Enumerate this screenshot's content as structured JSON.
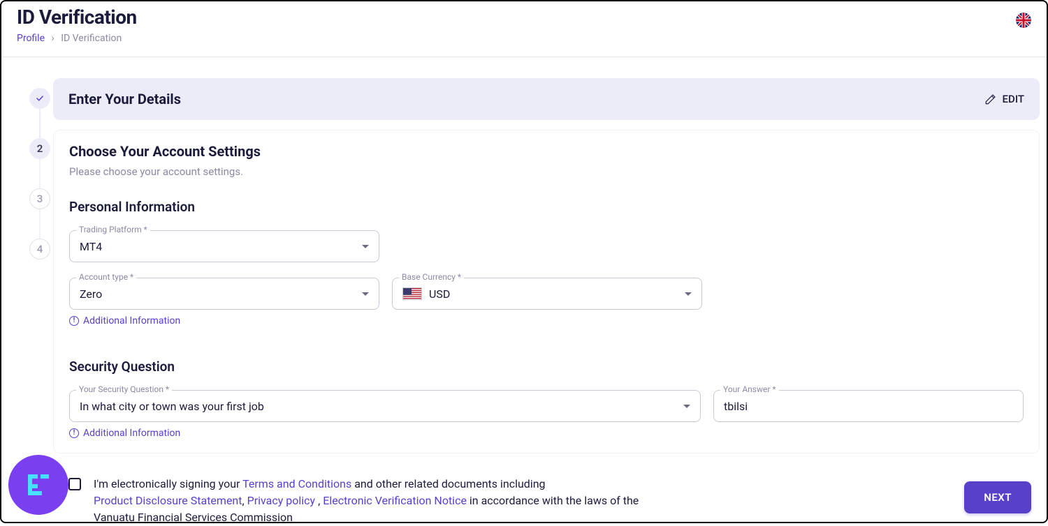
{
  "page_title": "ID Verification",
  "breadcrumb": {
    "profile": "Profile",
    "current": "ID Verification"
  },
  "stepper": {
    "steps": [
      "✓",
      "2",
      "3",
      "4"
    ]
  },
  "step1": {
    "title": "Enter Your Details",
    "edit": "EDIT"
  },
  "step2": {
    "title": "Choose Your Account Settings",
    "subtitle": "Please choose your account settings.",
    "section_personal": "Personal Information",
    "section_security": "Security Question",
    "fields": {
      "trading_platform": {
        "label": "Trading Platform *",
        "value": "MT4"
      },
      "account_type": {
        "label": "Account type *",
        "value": "Zero"
      },
      "base_currency": {
        "label": "Base Currency *",
        "value": "USD"
      },
      "security_question": {
        "label": "Your Security Question *",
        "value": "In what city or town was your first job"
      },
      "your_answer": {
        "label": "Your Answer *",
        "value": "tbilsi"
      }
    },
    "additional_info": "Additional Information"
  },
  "consent": {
    "prefix": "I'm electronically signing your ",
    "tac": "Terms and Conditions",
    "mid1": " and other related documents including ",
    "pds": "Product Disclosure Statement",
    "comma1": ", ",
    "privacy": "Privacy policy",
    "comma2": " , ",
    "evn": "Electronic Verification Notice",
    "suffix1": " in accordance with the laws of the ",
    "suffix2": "Vanuatu Financial Services Commission"
  },
  "next_button": "NEXT"
}
